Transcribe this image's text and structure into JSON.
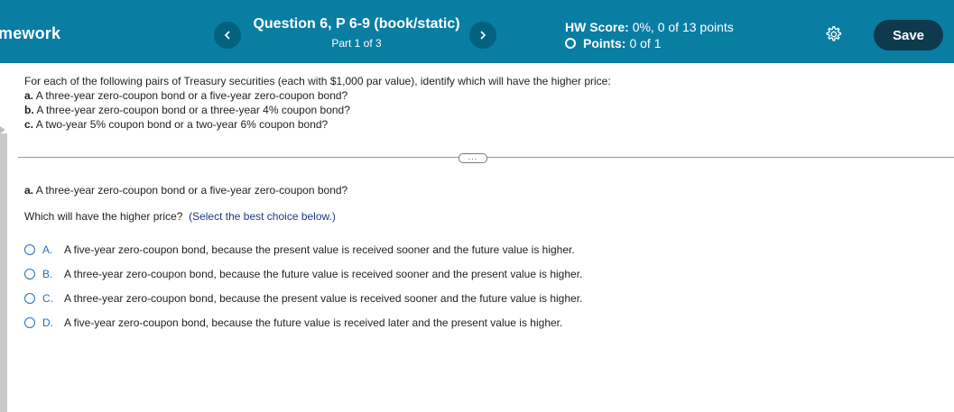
{
  "header": {
    "brand": "mework",
    "question_title": "Question 6, P 6-9 (book/static)",
    "part": "Part 1 of 3",
    "hw_score_label": "HW Score:",
    "hw_score_value": "0%, 0 of 13 points",
    "points_label": "Points:",
    "points_value": "0 of 1",
    "save_label": "Save"
  },
  "problem": {
    "intro": "For each of the following pairs of Treasury securities (each with $1,000 par value), identify which will have the higher price:",
    "items": [
      {
        "label": "a.",
        "text": "A three-year zero-coupon bond or a five-year zero-coupon bond?"
      },
      {
        "label": "b.",
        "text": "A three-year zero-coupon bond or a three-year 4% coupon bond?"
      },
      {
        "label": "c.",
        "text": "A two-year 5% coupon bond or a two-year 6% coupon bond?"
      }
    ]
  },
  "question": {
    "part_label": "a.",
    "part_text": "A three-year zero-coupon bond or a five-year zero-coupon bond?",
    "prompt": "Which will have the higher price?",
    "hint": "(Select the best choice below.)",
    "choices": [
      {
        "letter": "A.",
        "text": "A five-year zero-coupon bond, because the present value is received sooner and the future value is higher."
      },
      {
        "letter": "B.",
        "text": "A three-year zero-coupon bond, because the future value is received sooner and the present value is higher."
      },
      {
        "letter": "C.",
        "text": "A three-year zero-coupon bond, because the present value is received sooner and the future value is higher."
      },
      {
        "letter": "D.",
        "text": "A five-year zero-coupon bond, because the future value is received later and the present value is higher."
      }
    ]
  },
  "colors": {
    "header_bg": "#0a7da3",
    "save_bg": "#0f3a4d",
    "accent": "#2a6fb3"
  },
  "icons": [
    "chevron-left-icon",
    "chevron-right-icon",
    "gear-icon",
    "radio-icon"
  ]
}
